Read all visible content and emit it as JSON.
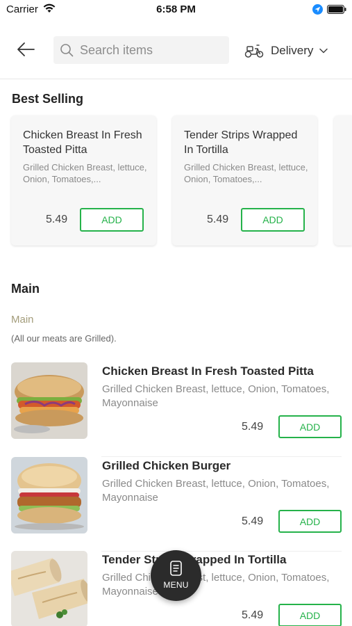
{
  "status_bar": {
    "carrier": "Carrier",
    "time": "6:58 PM"
  },
  "header": {
    "search": {
      "placeholder": "Search items",
      "value": ""
    },
    "delivery_mode": "Delivery"
  },
  "best_selling": {
    "title": "Best Selling",
    "items": [
      {
        "name": "Chicken Breast In Fresh Toasted Pitta",
        "description": "Grilled Chicken Breast, lettuce, Onion, Tomatoes,...",
        "price": "5.49",
        "add_label": "ADD"
      },
      {
        "name": "Tender Strips Wrapped In Tortilla",
        "description": "Grilled Chicken Breast, lettuce, Onion, Tomatoes,...",
        "price": "5.49",
        "add_label": "ADD"
      }
    ]
  },
  "main": {
    "title": "Main",
    "category": "Main",
    "category_note": "(All our meats are Grilled).",
    "items": [
      {
        "name": "Chicken Breast In Fresh Toasted Pitta",
        "description": "Grilled Chicken Breast, lettuce, Onion, Tomatoes, Mayonnaise",
        "price": "5.49",
        "add_label": "ADD",
        "image_icon": "pitta-sandwich-photo"
      },
      {
        "name": "Grilled Chicken Burger",
        "description": "Grilled Chicken Breast, lettuce, Onion, Tomatoes, Mayonnaise",
        "price": "5.49",
        "add_label": "ADD",
        "image_icon": "chicken-burger-photo"
      },
      {
        "name": "Tender Strips Wrapped In Tortilla",
        "description": "Grilled Chicken Breast, lettuce, Onion, Tomatoes, Mayonnaise",
        "price": "5.49",
        "add_label": "ADD",
        "image_icon": "tortilla-wrap-photo"
      }
    ]
  },
  "fab": {
    "label": "MENU"
  },
  "colors": {
    "accent": "#25b24a",
    "category": "#a39c7a",
    "fab_background": "#2b2b2b",
    "location_blue": "#1a8cff"
  }
}
